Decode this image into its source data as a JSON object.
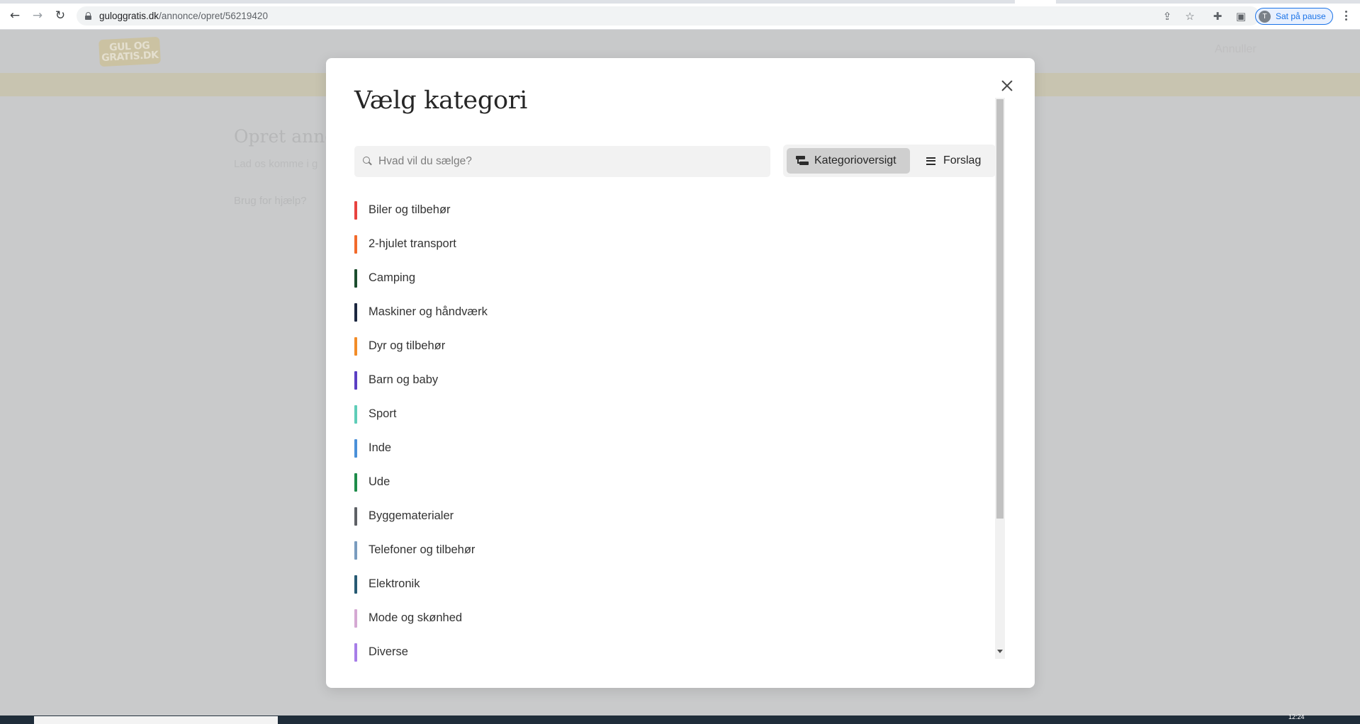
{
  "browser": {
    "url_domain": "guloggratis.dk",
    "url_path": "/annonce/opret/56219420",
    "profile_initial": "T",
    "profile_label": "Sat på pause"
  },
  "site": {
    "logo_line1": "GUL OG",
    "logo_line2": "GRATIS.DK",
    "cancel_label": "Annuller",
    "page_title": "Opret anno",
    "page_subtitle": "Lad os komme i g",
    "help_link": "Brug for hjælp?"
  },
  "modal": {
    "title": "Vælg kategori",
    "search_placeholder": "Hvad vil du sælge?",
    "toggle_overview": "Kategorioversigt",
    "toggle_suggestions": "Forslag",
    "categories": [
      {
        "label": "Biler og tilbehør",
        "color": "#e8433f"
      },
      {
        "label": "2-hjulet transport",
        "color": "#f26a2b"
      },
      {
        "label": "Camping",
        "color": "#1c4d2e"
      },
      {
        "label": "Maskiner og håndværk",
        "color": "#1c2740"
      },
      {
        "label": "Dyr og tilbehør",
        "color": "#f28c28"
      },
      {
        "label": "Barn og baby",
        "color": "#5b3fc4"
      },
      {
        "label": "Sport",
        "color": "#5fcdb8"
      },
      {
        "label": "Inde",
        "color": "#4a90d9"
      },
      {
        "label": "Ude",
        "color": "#1e8c4a"
      },
      {
        "label": "Byggematerialer",
        "color": "#5e6166"
      },
      {
        "label": "Telefoner og tilbehør",
        "color": "#7a9cbf"
      },
      {
        "label": "Elektronik",
        "color": "#275a73"
      },
      {
        "label": "Mode og skønhed",
        "color": "#d5a9d3"
      },
      {
        "label": "Diverse",
        "color": "#a77ee8"
      }
    ]
  },
  "taskbar": {
    "clock": "12:24"
  }
}
